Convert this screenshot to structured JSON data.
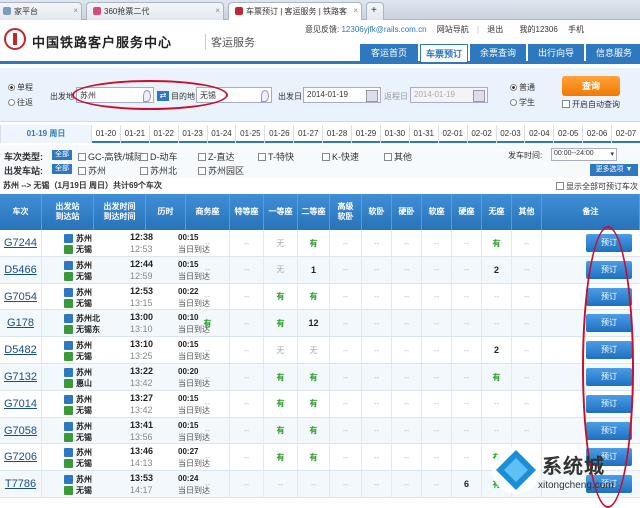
{
  "browser_tabs": [
    {
      "label": "家平台",
      "fav": "#7a9bc4"
    },
    {
      "label": "360抢票二代",
      "fav": "#d94a7a"
    },
    {
      "label": "车票预订 | 客运服务 | 铁路客",
      "fav": "#c0282e"
    }
  ],
  "header": {
    "title": "中国铁路客户服务中心",
    "subtitle": "客运服务",
    "feedback_label": "意见反馈:",
    "feedback_email": "12306yjfk@rails.com.cn",
    "links": [
      "网站导航",
      "退出",
      "我的12306",
      "手机"
    ],
    "nav": [
      "客运首页",
      "车票预订",
      "余票查询",
      "出行向导",
      "信息服务"
    ]
  },
  "search": {
    "trip_types": [
      "单程",
      "往返"
    ],
    "from_label": "出发地",
    "from_value": "苏州",
    "to_label": "目的地",
    "to_value": "无锡",
    "date_label": "出发日",
    "date_value": "2014-01-19",
    "return_label": "返程日",
    "return_value": "2014-01-19",
    "passenger_types": [
      "普通",
      "学生"
    ],
    "query_label": "查询",
    "auto_query_label": "开启自动查询"
  },
  "date_strip": [
    "01-19 周日",
    "01-20",
    "01-21",
    "01-22",
    "01-23",
    "01-24",
    "01-25",
    "01-26",
    "01-27",
    "01-28",
    "01-29",
    "01-30",
    "01-31",
    "02-01",
    "02-02",
    "02-03",
    "02-04",
    "02-05",
    "02-06",
    "02-07"
  ],
  "filters": {
    "type_label": "车次类型:",
    "all_label": "全部",
    "types": [
      "GC-高铁/城际",
      "D-动车",
      "Z-直达",
      "T-特快",
      "K-快速",
      "其他"
    ],
    "station_label": "出发车站:",
    "stations": [
      "苏州",
      "苏州北",
      "苏州园区"
    ],
    "depart_time_label": "发车时间:",
    "depart_time_value": "00:00--24:00",
    "more_label": "更多选项 ▼"
  },
  "summary": {
    "route": "苏州 --> 无锡（1月19日 周日）共计69个车次",
    "show_all_label": "显示全部可预订车次"
  },
  "table_headers": [
    "车次",
    "出发站\n到达站",
    "出发时间\n到达时间",
    "历时",
    "商务座",
    "特等座",
    "一等座",
    "二等座",
    "高级\n软卧",
    "软卧",
    "硬卧",
    "软座",
    "硬座",
    "无座",
    "其他",
    "备注"
  ],
  "rows": [
    {
      "no": "G7244",
      "from": "苏州",
      "to": "无锡",
      "dep": "12:38",
      "arr": "12:53",
      "dur": "00:15",
      "day": "当日到达",
      "seats": [
        "--",
        "--",
        "无",
        "有",
        "--",
        "--",
        "--",
        "--",
        "--",
        "有",
        "--"
      ],
      "book": "预订"
    },
    {
      "no": "D5466",
      "from": "苏州",
      "to": "无锡",
      "dep": "12:44",
      "arr": "12:59",
      "dur": "00:15",
      "day": "当日到达",
      "seats": [
        "--",
        "--",
        "无",
        "1",
        "--",
        "--",
        "--",
        "--",
        "--",
        "2",
        "--"
      ],
      "book": "预订"
    },
    {
      "no": "G7054",
      "from": "苏州",
      "to": "无锡",
      "dep": "12:53",
      "arr": "13:15",
      "dur": "00:22",
      "day": "当日到达",
      "seats": [
        "--",
        "--",
        "有",
        "有",
        "--",
        "--",
        "--",
        "--",
        "--",
        "--",
        "--"
      ],
      "book": "预订"
    },
    {
      "no": "G178",
      "from": "苏州北",
      "to": "无锡东",
      "dep": "13:00",
      "arr": "13:10",
      "dur": "00:10",
      "day": "当日到达",
      "seats": [
        "有",
        "--",
        "有",
        "12",
        "--",
        "--",
        "--",
        "--",
        "--",
        "--",
        "--"
      ],
      "book": "预订"
    },
    {
      "no": "D5482",
      "from": "苏州",
      "to": "无锡",
      "dep": "13:10",
      "arr": "13:25",
      "dur": "00:15",
      "day": "当日到达",
      "seats": [
        "--",
        "--",
        "无",
        "无",
        "--",
        "--",
        "--",
        "--",
        "--",
        "2",
        "--"
      ],
      "book": "预订"
    },
    {
      "no": "G7132",
      "from": "苏州",
      "to": "惠山",
      "dep": "13:22",
      "arr": "13:42",
      "dur": "00:20",
      "day": "当日到达",
      "seats": [
        "--",
        "--",
        "有",
        "有",
        "--",
        "--",
        "--",
        "--",
        "--",
        "有",
        "--"
      ],
      "book": "预订"
    },
    {
      "no": "G7014",
      "from": "苏州",
      "to": "无锡",
      "dep": "13:27",
      "arr": "13:42",
      "dur": "00:15",
      "day": "当日到达",
      "seats": [
        "--",
        "--",
        "有",
        "有",
        "--",
        "--",
        "--",
        "--",
        "--",
        "--",
        "--"
      ],
      "book": "预订"
    },
    {
      "no": "G7058",
      "from": "苏州",
      "to": "无锡",
      "dep": "13:41",
      "arr": "13:56",
      "dur": "00:15",
      "day": "当日到达",
      "seats": [
        "--",
        "--",
        "有",
        "有",
        "--",
        "--",
        "--",
        "--",
        "--",
        "--",
        "--"
      ],
      "book": "预订"
    },
    {
      "no": "G7206",
      "from": "苏州",
      "to": "无锡",
      "dep": "13:46",
      "arr": "14:13",
      "dur": "00:27",
      "day": "当日到达",
      "seats": [
        "--",
        "--",
        "有",
        "有",
        "--",
        "--",
        "--",
        "--",
        "--",
        "有",
        "--"
      ],
      "book": "预订"
    },
    {
      "no": "T7786",
      "from": "苏州",
      "to": "无锡",
      "dep": "13:53",
      "arr": "14:17",
      "dur": "00:24",
      "day": "当日到达",
      "seats": [
        "--",
        "--",
        "--",
        "--",
        "--",
        "--",
        "--",
        "--",
        "6",
        "有",
        "--"
      ],
      "book": "预订"
    }
  ],
  "watermark": {
    "brand": "系统城",
    "url": "xitongcheng.com"
  }
}
